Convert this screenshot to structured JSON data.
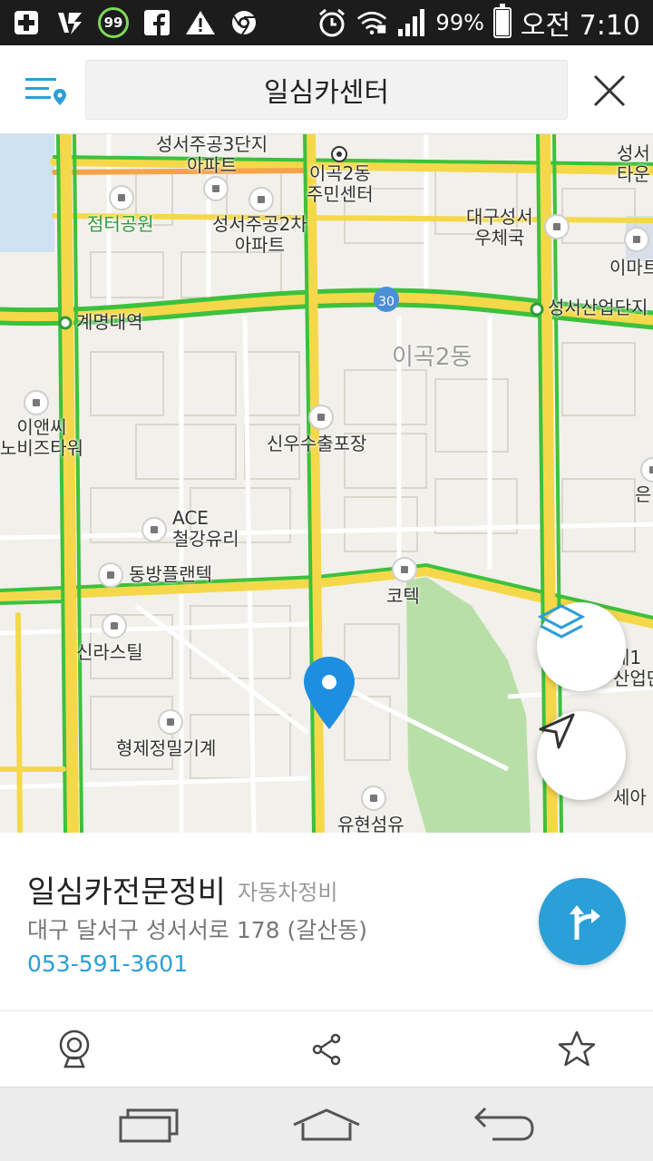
{
  "status_bar": {
    "battery_percent": "99%",
    "clock": "오전 7:10",
    "notification_badge": "99",
    "icons": [
      "plus-icon",
      "v3-icon",
      "badge-99-icon",
      "facebook-icon",
      "warning-icon",
      "chrome-icon",
      "alarm-icon",
      "wifi-icon",
      "signal-icon",
      "battery-icon"
    ]
  },
  "header": {
    "search_query": "일심카센터"
  },
  "map": {
    "labels": {
      "apartment_3": "성서주공3단지\n아파트",
      "igok2dong_center": "이곡2동\n주민센터",
      "daegu_seongseo_post": "대구성서\n우체국",
      "seongseo_corner": "성서\n타운",
      "jeomteo_park": "점터공원",
      "apartment_2": "성서주공2차\n아파트",
      "emart": "이마트",
      "route_number": "30",
      "gyemyeong_station": "계명대역",
      "seongseo_industrial": "성서산업단지",
      "dong_area": "이곡2동",
      "ian_c": "이앤씨\n노비즈타워",
      "sinwoo": "신우수출포장",
      "eun": "은",
      "ace": "ACE\n철강유리",
      "dongbang": "동방플랜텍",
      "kotek": "코텍",
      "sinraseutil": "신라스틸",
      "je1": "제1\n산업단",
      "hyeongje": "형제정밀기계",
      "sea": "세아",
      "yuhyeon": "유현섬유"
    }
  },
  "place": {
    "name": "일심카전문정비",
    "category": "자동차정비",
    "address": "대구 달서구 성서서로 178 (갈산동)",
    "phone": "053-591-3601"
  },
  "colors": {
    "accent": "#2a9fd8",
    "road_green": "#3cc13c",
    "road_yellow": "#f5d84a",
    "map_bg": "#f2f0ea",
    "park": "#b9dfa8",
    "water": "#cfe2f3"
  }
}
